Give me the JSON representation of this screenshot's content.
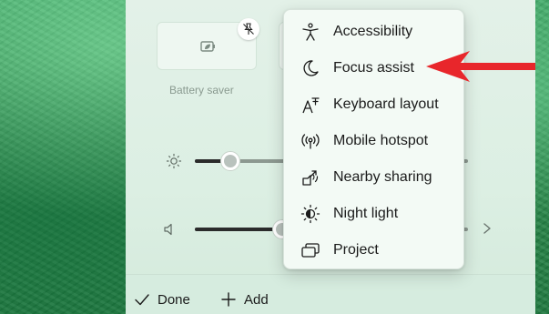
{
  "quick_settings": {
    "tiles": [
      {
        "label": "Battery saver",
        "icon": "battery-leaf-icon"
      }
    ],
    "unpin_icon": "unpin-icon",
    "sliders": [
      {
        "name": "brightness",
        "icon": "brightness-icon",
        "level": 0.17
      },
      {
        "name": "volume",
        "icon": "speaker-icon",
        "level": 0.45
      }
    ],
    "footer": {
      "done_label": "Done",
      "add_label": "Add"
    }
  },
  "context_menu": {
    "items": [
      {
        "label": "Accessibility",
        "icon": "accessibility-icon"
      },
      {
        "label": "Focus assist",
        "icon": "moon-icon"
      },
      {
        "label": "Keyboard layout",
        "icon": "keyboard-layout-icon"
      },
      {
        "label": "Mobile hotspot",
        "icon": "hotspot-icon"
      },
      {
        "label": "Nearby sharing",
        "icon": "nearby-share-icon"
      },
      {
        "label": "Night light",
        "icon": "night-light-icon"
      },
      {
        "label": "Project",
        "icon": "project-icon"
      }
    ]
  },
  "colors": {
    "accent_arrow": "#e8262b",
    "panel_bg": "#e3f1e8",
    "menu_bg": "#f3faf5"
  }
}
